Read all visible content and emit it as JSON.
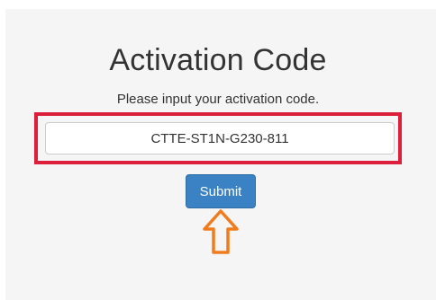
{
  "page": {
    "title": "Activation Code",
    "subtitle": "Please input your activation code."
  },
  "form": {
    "code_value": "CTTE-ST1N-G230-811",
    "submit_label": "Submit"
  },
  "annotations": {
    "highlight_color": "#dc1f3a",
    "arrow_color": "#f07c1e",
    "arrow_icon": "arrow-up-icon"
  },
  "colors": {
    "background": "#f5f5f5",
    "button": "#3a82c4"
  }
}
